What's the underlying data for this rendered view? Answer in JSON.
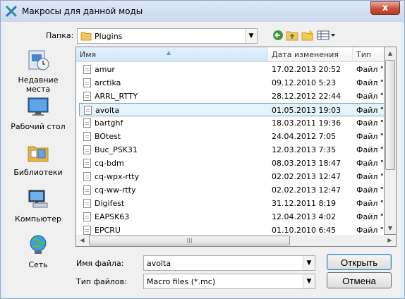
{
  "window": {
    "title": "Макросы для данной моды",
    "close_label": "x"
  },
  "toolbar": {
    "lookin_label": "Папка:",
    "lookin_value": "Plugins",
    "icons": [
      "back-icon",
      "up-folder-icon",
      "new-folder-icon",
      "view-menu-icon"
    ]
  },
  "places": [
    {
      "label": "Недавние места",
      "icon": "recent-places-icon"
    },
    {
      "label": "Рабочий стол",
      "icon": "desktop-icon"
    },
    {
      "label": "Библиотеки",
      "icon": "libraries-icon"
    },
    {
      "label": "Компьютер",
      "icon": "computer-icon"
    },
    {
      "label": "Сеть",
      "icon": "network-icon"
    }
  ],
  "columns": {
    "name": "Имя",
    "date": "Дата изменения",
    "type": "Тип"
  },
  "files": [
    {
      "name": "amur",
      "date": "17.02.2013 20:52",
      "type": "Файл \""
    },
    {
      "name": "arctika",
      "date": "09.12.2010 5:23",
      "type": "Файл \""
    },
    {
      "name": "ARRL_RTTY",
      "date": "28.12.2012 22:44",
      "type": "Файл \""
    },
    {
      "name": "avolta",
      "date": "01.05.2013 19:03",
      "type": "Файл \"",
      "selected": true
    },
    {
      "name": "bartghf",
      "date": "18.03.2011 19:36",
      "type": "Файл \""
    },
    {
      "name": "BOtest",
      "date": "24.04.2012 7:05",
      "type": "Файл \""
    },
    {
      "name": "Buc_PSK31",
      "date": "12.03.2013 7:35",
      "type": "Файл \""
    },
    {
      "name": "cq-bdm",
      "date": "08.03.2013 18:47",
      "type": "Файл \""
    },
    {
      "name": "cq-wpx-rtty",
      "date": "02.02.2013 12:47",
      "type": "Файл \""
    },
    {
      "name": "cq-ww-rtty",
      "date": "02.02.2013 12:47",
      "type": "Файл \""
    },
    {
      "name": "Digifest",
      "date": "31.12.2011 8:19",
      "type": "Файл \""
    },
    {
      "name": "EAPSK63",
      "date": "12.04.2013 4:02",
      "type": "Файл \""
    },
    {
      "name": "EPCRU",
      "date": "01.10.2010 6:45",
      "type": "Файл \""
    }
  ],
  "filename": {
    "label": "Имя файла:",
    "value": "avolta"
  },
  "filetype": {
    "label": "Тип файлов:",
    "value": "Macro files (*.mc)"
  },
  "buttons": {
    "open": "Открыть",
    "cancel": "Отмена"
  }
}
